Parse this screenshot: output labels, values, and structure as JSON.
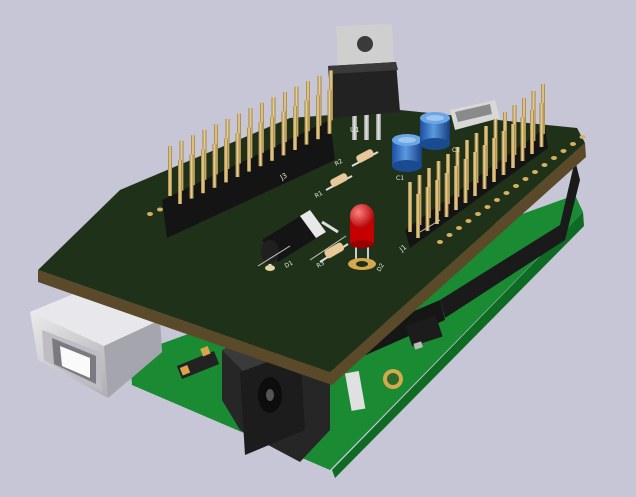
{
  "scene": {
    "background_color": "#c6c6d6",
    "shield_pcb_color": "#1f3219",
    "arduino_pcb_color": "#1f9b3a",
    "silkscreen_color": "#e8e8e0"
  },
  "labels": {
    "header_j1": "J1",
    "header_j3": "J3",
    "regulator_u1": "U1",
    "cap_c1": "C1",
    "cap_c2": "C2",
    "led_d2": "D2",
    "resistor_r1": "R1",
    "resistor_r2": "R2",
    "resistor_r3": "R3",
    "diode_d1": "D1"
  }
}
